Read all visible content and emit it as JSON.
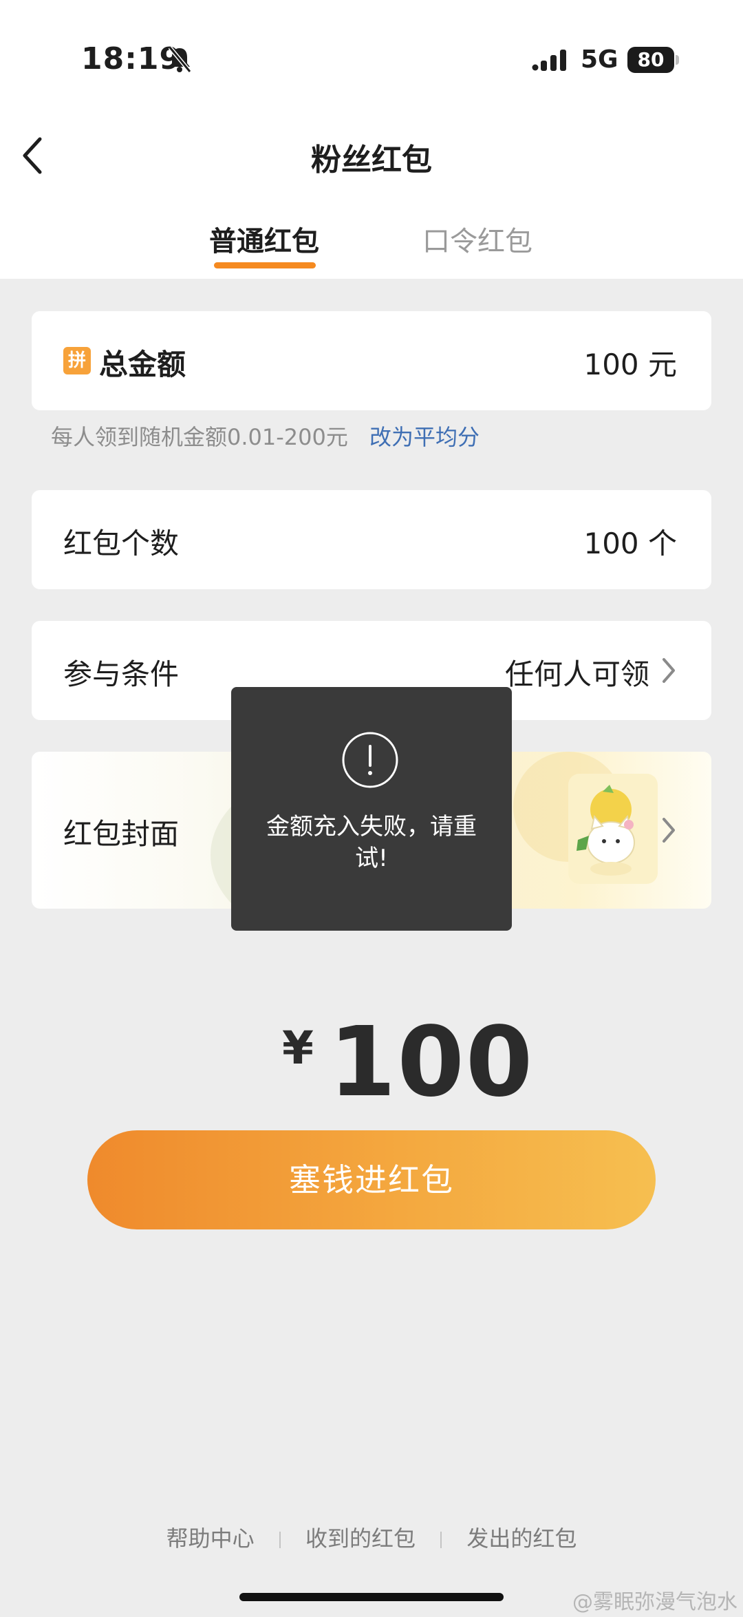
{
  "status_bar": {
    "time": "18:19",
    "network": "5G",
    "battery": "80"
  },
  "nav": {
    "title": "粉丝红包"
  },
  "tabs": [
    {
      "label": "普通红包",
      "active": true
    },
    {
      "label": "口令红包",
      "active": false
    }
  ],
  "total_amount": {
    "badge": "拼",
    "label": "总金额",
    "value": "100 元"
  },
  "hint": {
    "text": "每人领到随机金额0.01-200元",
    "link": "改为平均分"
  },
  "count": {
    "label": "红包个数",
    "value": "100 个"
  },
  "condition": {
    "label": "参与条件",
    "value": "任何人可领"
  },
  "cover": {
    "label": "红包封面"
  },
  "amount": {
    "currency": "¥",
    "value": "100"
  },
  "submit_button": {
    "label": "塞钱进红包"
  },
  "toast": {
    "message": "金额充入失败，请重试!"
  },
  "footer": {
    "links": [
      "帮助中心",
      "收到的红包",
      "发出的红包"
    ]
  },
  "watermark": "@雾眠弥漫气泡水",
  "colors": {
    "accent": "#f58a20",
    "link": "#3f6fb4",
    "background": "#ededed",
    "toast": "#3a3a3a"
  }
}
